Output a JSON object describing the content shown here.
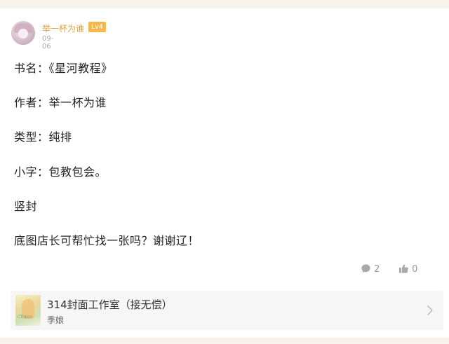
{
  "post": {
    "author": {
      "name": "举一杯为谁",
      "level": "Lv4",
      "date": "09-06"
    },
    "lines": [
      "书名：《星河教程》",
      "作者：举一杯为谁",
      "类型：纯排",
      "小字：包教包会。",
      "竖封",
      "底图店长可帮忙找一张吗？谢谢辽！"
    ],
    "stats": {
      "comments": "2",
      "likes": "0"
    }
  },
  "work_card": {
    "title": "314封面工作室（接无偿）",
    "subtitle": "季娘",
    "cover_text": "Clinico"
  },
  "colors": {
    "username": "#e0a242",
    "level_badge": "#f2b84b",
    "page_background": "#f7f3ea"
  }
}
